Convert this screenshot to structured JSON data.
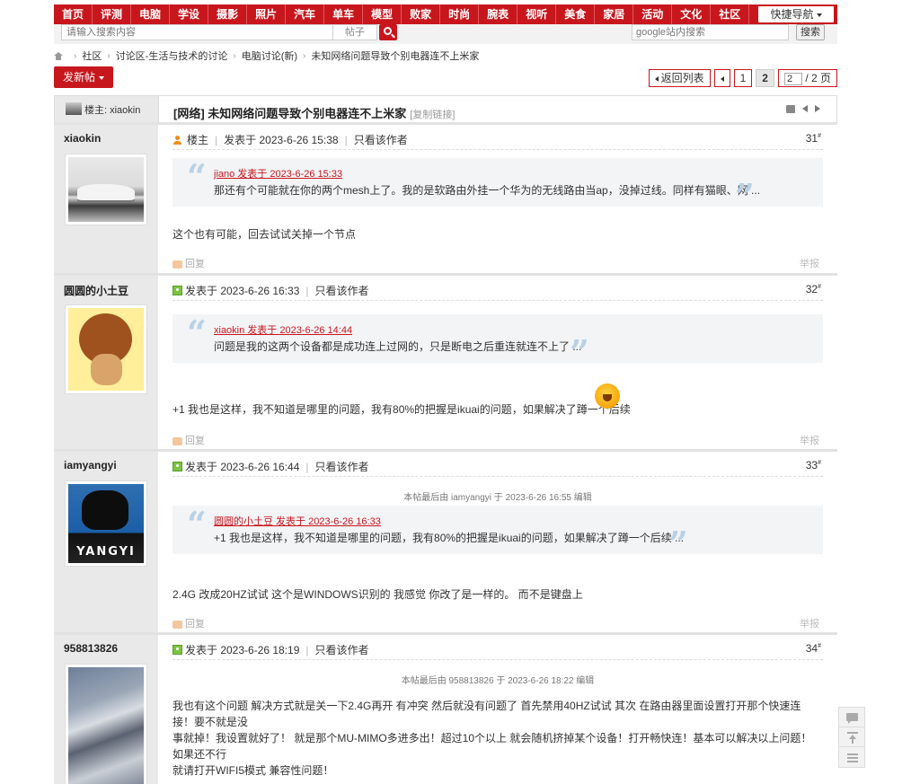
{
  "topnav": {
    "items": [
      "首页",
      "评测",
      "电脑",
      "学设",
      "摄影",
      "照片",
      "汽车",
      "单车",
      "模型",
      "败家",
      "时尚",
      "腕表",
      "视听",
      "美食",
      "家居",
      "活动",
      "文化",
      "社区"
    ],
    "quick_nav": "快捷导航"
  },
  "search": {
    "placeholder": "请输入搜索内容",
    "type": "帖子",
    "google_placeholder": "google站内搜索",
    "google_button": "搜索"
  },
  "breadcrumb": [
    "社区",
    "讨论区-生活与技术的讨论",
    "电脑讨论(新)",
    "未知网络问题导致个别电器连不上米家"
  ],
  "actions": {
    "new_post": "发新帖",
    "back_to_list": "返回列表",
    "pages": [
      "1",
      "2"
    ],
    "current_page": "2",
    "page_input": "2",
    "total_pages": "/ 2 页"
  },
  "thread": {
    "host_label": "楼主: xiaokin",
    "title": "[网络] 未知网络问题导致个别电器连不上米家",
    "copy_link": "[复制链接]"
  },
  "common": {
    "only_author": "只看该作者",
    "reply": "回复",
    "report": "举报",
    "host_tag": "楼主"
  },
  "posts": [
    {
      "user": "xiaokin",
      "posted": "发表于 2023-6-26 15:38",
      "floor": "31",
      "quote_author": "jiano 发表于 2023-6-26 15:33",
      "quote_text": "那还有个可能就在你的两个mesh上了。我的是软路由外挂一个华为的无线路由当ap，没掉过线。同样有猫眼、网 ...",
      "body": "这个也有可能，回去试试关掉一个节点"
    },
    {
      "user": "圆圆的小土豆",
      "posted": "发表于 2023-6-26 16:33",
      "floor": "32",
      "quote_author": "xiaokin 发表于 2023-6-26 14:44",
      "quote_text": "问题是我的这两个设备都是成功连上过网的，只是断电之后重连就连不上了 ...",
      "body": "+1 我也是这样，我不知道是哪里的问题，我有80%的把握是ikuai的问题，如果解决了蹲一个后续"
    },
    {
      "user": "iamyangyi",
      "posted": "发表于 2023-6-26 16:44",
      "floor": "33",
      "edited": "本帖最后由 iamyangyi 于 2023-6-26 16:55 编辑",
      "quote_author": "圆圆的小土豆 发表于 2023-6-26 16:33",
      "quote_text": "+1 我也是这样，我不知道是哪里的问题，我有80%的把握是ikuai的问题，如果解决了蹲一个后续 ...",
      "body": "2.4G 改成20HZ试试 这个是WINDOWS识别的 我感觉 你改了是一样的。 而不是键盘上",
      "avatar_text": "YANGYI"
    },
    {
      "user": "958813826",
      "posted": "发表于 2023-6-26 18:19",
      "floor": "34",
      "edited": "本帖最后由 958813826 于 2023-6-26 18:22 编辑",
      "body_lines": [
        "我也有这个问题 解决方式就是关一下2.4G再开 有冲突 然后就没有问题了 首先禁用40HZ试试  其次 在路由器里面设置打开那个快速连接！要不就是没",
        "事就掉！我设置就好了！ 就是那个MU-MIMO多进多出！超过10个以上 就会随机挤掉某个设备！打开畅快连！基本可以解决以上问题！ 如果还不行",
        "就请打开WIFI5模式 兼容性问题！"
      ]
    }
  ]
}
